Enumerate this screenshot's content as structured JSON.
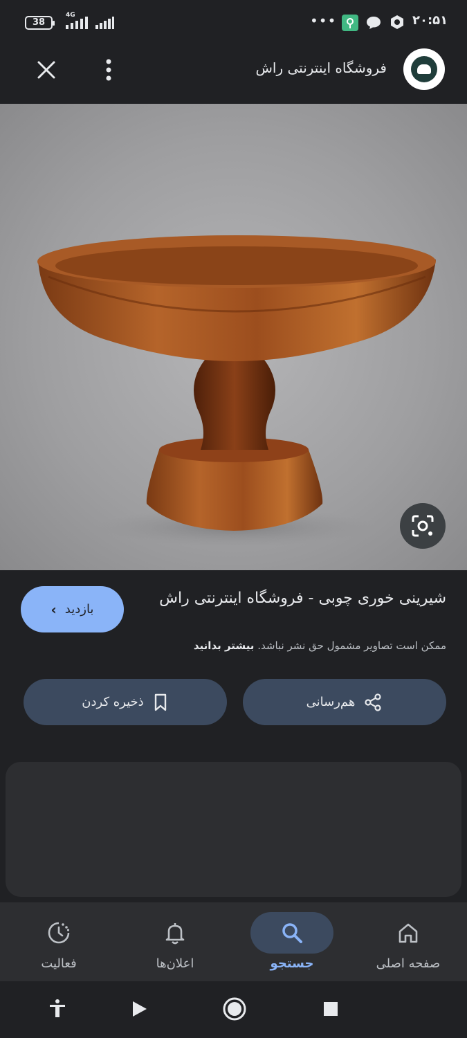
{
  "status_bar": {
    "battery": "38",
    "network": "4G",
    "time": "۲۰:۵۱",
    "dots": "•••"
  },
  "app_bar": {
    "site_title": "فروشگاه اینترنتی راش"
  },
  "result": {
    "title": "شیرینی خوری چوبی - فروشگاه اینترنتی راش",
    "copyright_text": "ممکن است تصاویر مشمول حق نشر نباشد.",
    "learn_more": "بیشتر بدانید",
    "visit_label": "بازدید",
    "save_label": "ذخیره کردن",
    "share_label": "هم‌رسانی"
  },
  "bottom_nav": {
    "items": [
      {
        "label": "صفحه اصلی",
        "icon": "home-icon"
      },
      {
        "label": "جستجو",
        "icon": "search-icon",
        "active": true
      },
      {
        "label": "اعلان‌ها",
        "icon": "bell-icon"
      },
      {
        "label": "فعالیت",
        "icon": "activity-icon"
      }
    ]
  },
  "colors": {
    "background": "#202124",
    "accent": "#8ab4f8",
    "chip": "#3c4a5f"
  }
}
